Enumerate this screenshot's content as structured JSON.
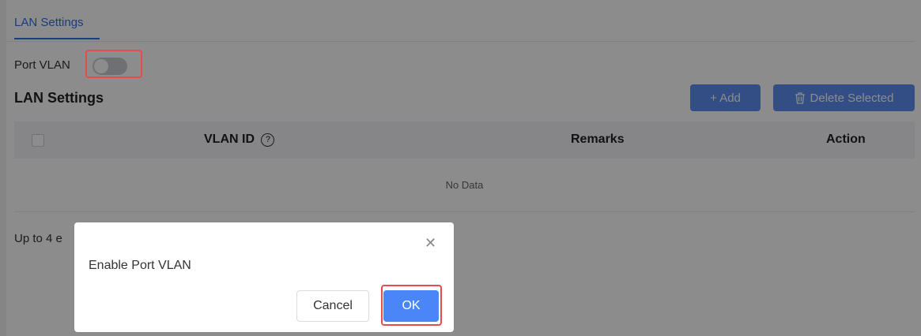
{
  "tabs": [
    {
      "label": "LAN Settings",
      "active": true
    }
  ],
  "port_vlan": {
    "label": "Port VLAN",
    "enabled": false
  },
  "section": {
    "title": "LAN Settings"
  },
  "toolbar": {
    "add_label": "+ Add",
    "delete_label": "Delete Selected",
    "delete_icon": "trash-icon"
  },
  "table": {
    "columns": [
      {
        "label": "VLAN ID",
        "help_icon": "question-circle-icon"
      },
      {
        "label": "Remarks"
      },
      {
        "label": "Action"
      }
    ],
    "empty_text": "No Data"
  },
  "footer_text": "Up to 4 e",
  "dialog": {
    "message": "Enable Port VLAN",
    "cancel_label": "Cancel",
    "ok_label": "OK",
    "close_icon": "close-icon"
  },
  "colors": {
    "accent": "#2f6fe6",
    "highlight": "#e74c4c",
    "ok_button": "#4a86f7"
  }
}
